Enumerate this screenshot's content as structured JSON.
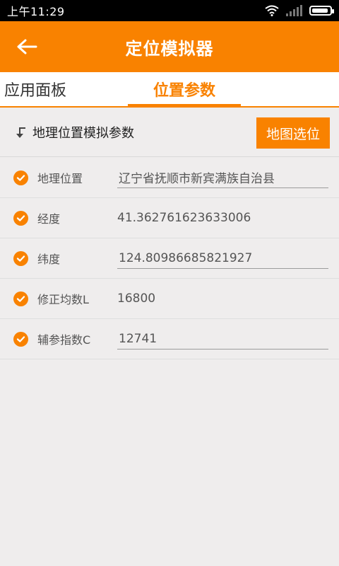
{
  "status_bar": {
    "time": "上午11:29"
  },
  "app_bar": {
    "title": "定位模拟器"
  },
  "tabs": [
    {
      "label": "应用面板",
      "active": false
    },
    {
      "label": "位置参数",
      "active": true
    }
  ],
  "section": {
    "title": "地理位置模拟参数",
    "map_button_label": "地图选位"
  },
  "rows": [
    {
      "label": "地理位置",
      "value": "辽宁省抚顺市新宾满族自治县"
    },
    {
      "label": "经度",
      "value": "41.362761623633006"
    },
    {
      "label": "纬度",
      "value": "124.80986685821927"
    },
    {
      "label": "修正均数L",
      "value": "16800"
    },
    {
      "label": "辅参指数C",
      "value": "12741"
    }
  ],
  "colors": {
    "accent": "#f98200",
    "background": "#efeded"
  }
}
